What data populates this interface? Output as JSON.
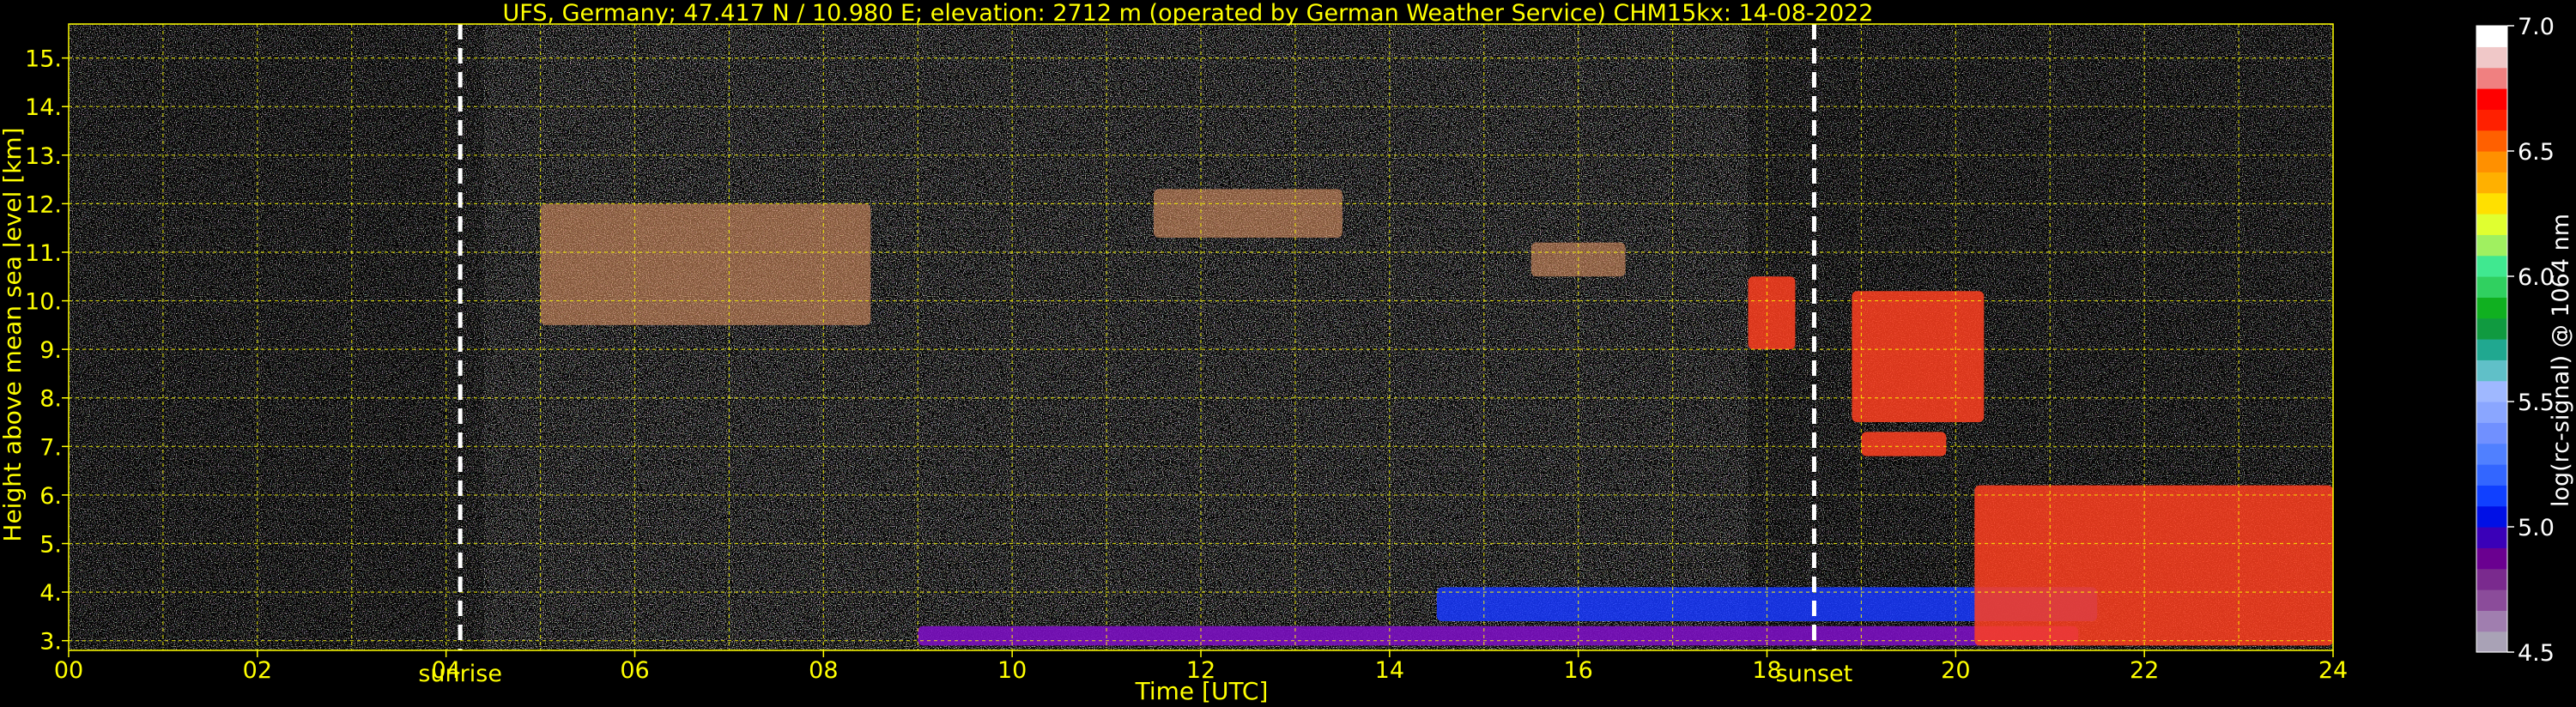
{
  "chart_data": {
    "type": "heatmap",
    "title": "UFS, Germany; 47.417 N / 10.980 E; elevation: 2712 m  (operated by German Weather Service)    CHM15kx: 14-08-2022",
    "xlabel": "Time [UTC]",
    "ylabel": "Height above mean sea level [km]",
    "xlim": [
      0,
      24
    ],
    "ylim": [
      2.8,
      15.7
    ],
    "x_ticks": [
      0,
      2,
      4,
      6,
      8,
      10,
      12,
      14,
      16,
      18,
      20,
      22,
      24
    ],
    "x_tick_labels": [
      "00",
      "02",
      "04",
      "06",
      "08",
      "10",
      "12",
      "14",
      "16",
      "18",
      "20",
      "22",
      "24"
    ],
    "y_ticks": [
      3,
      4,
      5,
      6,
      7,
      8,
      9,
      10,
      11,
      12,
      13,
      14,
      15
    ],
    "y_tick_labels": [
      "3.",
      "4.",
      "5.",
      "6.",
      "7.",
      "8.",
      "9.",
      "10.",
      "11.",
      "12.",
      "13.",
      "14.",
      "15."
    ],
    "grid": true,
    "annotations": [
      {
        "label": "sunrise",
        "x": 4.15
      },
      {
        "label": "sunset",
        "x": 18.5
      }
    ],
    "colorbar": {
      "label": "log(rc-signal) @ 1064 nm",
      "range": [
        4.5,
        7.0
      ],
      "ticks": [
        4.5,
        5.0,
        5.5,
        6.0,
        6.5,
        7.0
      ],
      "tick_labels": [
        "4.5",
        "5.0",
        "5.5",
        "6.0",
        "6.5",
        "7.0"
      ],
      "colors": [
        "#a9a2b6",
        "#a07eaf",
        "#8b4c9a",
        "#7a2a8e",
        "#6a0090",
        "#3a00b8",
        "#0010e6",
        "#1040ff",
        "#3366ff",
        "#5080ff",
        "#7090ff",
        "#8aa6ff",
        "#9fb8ff",
        "#60c0c8",
        "#20a890",
        "#109a40",
        "#10b020",
        "#30d060",
        "#40e890",
        "#a0f060",
        "#e0ff30",
        "#ffe000",
        "#ffb000",
        "#ff9000",
        "#ff6000",
        "#ff2000",
        "#ff0000",
        "#f08080",
        "#f0c8c8",
        "#ffffff"
      ]
    },
    "features": [
      {
        "kind": "boundary_layer",
        "x_range": [
          9.0,
          21.3
        ],
        "height_km": [
          2.9,
          3.3
        ]
      },
      {
        "kind": "noisy_layer",
        "x_range": [
          14.5,
          21.5
        ],
        "height_km": [
          3.4,
          4.1
        ]
      },
      {
        "kind": "cloud",
        "x_range": [
          17.8,
          18.3
        ],
        "height_km": [
          9.0,
          10.5
        ]
      },
      {
        "kind": "cloud",
        "x_range": [
          18.9,
          20.3
        ],
        "height_km": [
          7.5,
          10.2
        ]
      },
      {
        "kind": "cloud",
        "x_range": [
          19.0,
          19.9
        ],
        "height_km": [
          6.8,
          7.3
        ]
      },
      {
        "kind": "cloud",
        "x_range": [
          20.2,
          24.0
        ],
        "height_km": [
          2.9,
          6.2
        ]
      },
      {
        "kind": "cirrus",
        "x_range": [
          5.0,
          8.5
        ],
        "height_km": [
          9.5,
          12.0
        ]
      },
      {
        "kind": "cirrus",
        "x_range": [
          11.5,
          13.5
        ],
        "height_km": [
          11.3,
          12.3
        ]
      },
      {
        "kind": "cirrus",
        "x_range": [
          15.5,
          16.5
        ],
        "height_km": [
          10.5,
          11.2
        ]
      }
    ]
  }
}
